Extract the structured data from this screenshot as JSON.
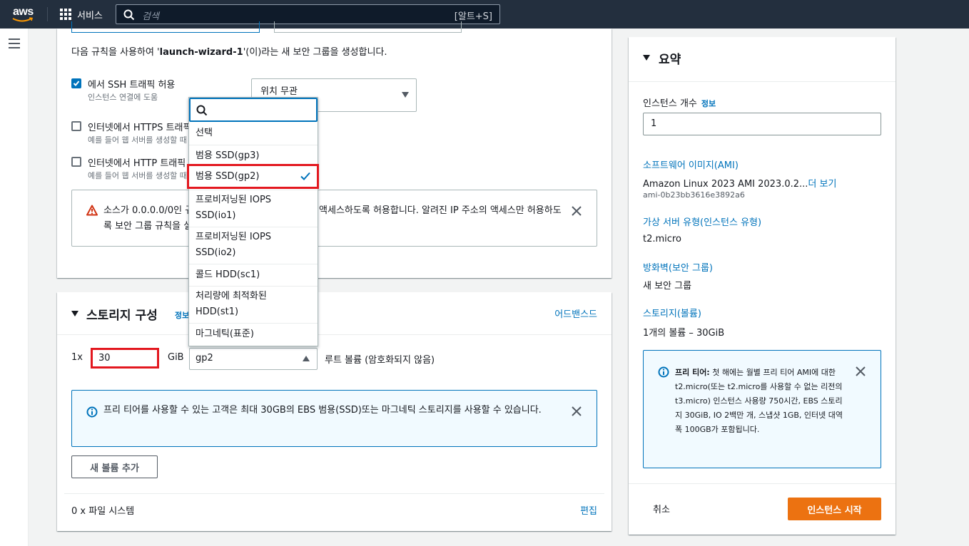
{
  "nav": {
    "brand": "aws",
    "services_label": "서비스",
    "search_placeholder": "검색",
    "search_shortcut": "[알트+S]"
  },
  "network": {
    "rule_prefix": "다음 규칙을 사용하여 '",
    "rule_group": "launch-wizard-1",
    "rule_suffix": "'(이)라는 새 보안 그룹을 생성합니다.",
    "rules": [
      {
        "label": "에서 SSH 트래픽 허용",
        "sub": "인스턴스 연결에 도움",
        "checked": true
      },
      {
        "label": "인터넷에서 HTTPS 트래픽 허용",
        "sub": "예를 들어 웹 서버를 생성할 때",
        "checked": false
      },
      {
        "label": "인터넷에서 HTTP 트래픽 허용",
        "sub": "예를 들어 웹 서버를 생성할 때",
        "checked": false
      }
    ],
    "location_value": "위치 무관",
    "warning_text": "소스가 0.0.0.0/0인 규칙은 모든 IP 주소가 인스턴스에 액세스하도록 허용합니다. 알려진 IP 주소의 액세스만 허용하도록 보안 그룹 규칙을 설정하는 것이 좋습니다."
  },
  "storage": {
    "title": "스토리지 구성",
    "info": "정보",
    "advanced": "어드밴스드",
    "volume_count_prefix": "1x",
    "volume_size": "30",
    "volume_unit": "GiB",
    "volume_type": "gp2",
    "volume_note": "루트 볼륨  (암호화되지 않음)",
    "info_text": "프리 티어를 사용할 수 있는 고객은 최대 30GB의 EBS 범용(SSD)또는 마그네틱 스토리지를 사용할 수 있습니다.",
    "add_volume": "새 볼륨 추가",
    "filesystems": "0 x 파일 시스템",
    "edit": "편집"
  },
  "dropdown": {
    "items": [
      {
        "label": "선택",
        "selected": false
      },
      {
        "label": "범용 SSD(gp3)",
        "selected": false
      },
      {
        "label": "범용 SSD(gp2)",
        "selected": true
      },
      {
        "label": "프로비저닝된 IOPS SSD(io1)",
        "selected": false
      },
      {
        "label": "프로비저닝된 IOPS SSD(io2)",
        "selected": false
      },
      {
        "label": "콜드 HDD(sc1)",
        "selected": false
      },
      {
        "label": "처리량에 최적화된 HDD(st1)",
        "selected": false
      },
      {
        "label": "마그네틱(표준)",
        "selected": false
      }
    ]
  },
  "summary": {
    "title": "요약",
    "instance_count_label": "인스턴스 개수",
    "info": "정보",
    "instance_count": "1",
    "ami_label": "소프트웨어 이미지(AMI)",
    "ami_value": "Amazon Linux 2023 AMI 2023.0.2...",
    "ami_more": "더 보기",
    "ami_id": "ami-0b23bb3616e3892a6",
    "instance_type_label": "가상 서버 유형(인스턴스 유형)",
    "instance_type": "t2.micro",
    "firewall_label": "방화벽(보안 그룹)",
    "firewall_value": "새 보안 그룹",
    "storage_label": "스토리지(볼륨)",
    "storage_value": "1개의 볼륨 – 30GiB",
    "free_tier_title": "프리 티어:",
    "free_tier_text": " 첫 해에는 월별 프리 티어 AMI에 대한 t2.micro(또는 t2.micro를 사용할 수 없는 리전의 t3.micro) 인스턴스 사용량 750시간, EBS 스토리지 30GiB, IO 2백만 개, 스냅샷 1GB, 인터넷 대역폭 100GB가 포함됩니다.",
    "cancel": "취소",
    "launch": "인스턴스 시작"
  },
  "colors": {
    "nav_bg": "#232f3e",
    "link": "#0073bb",
    "primary_button": "#ec7211",
    "highlight": "#e3181f"
  }
}
